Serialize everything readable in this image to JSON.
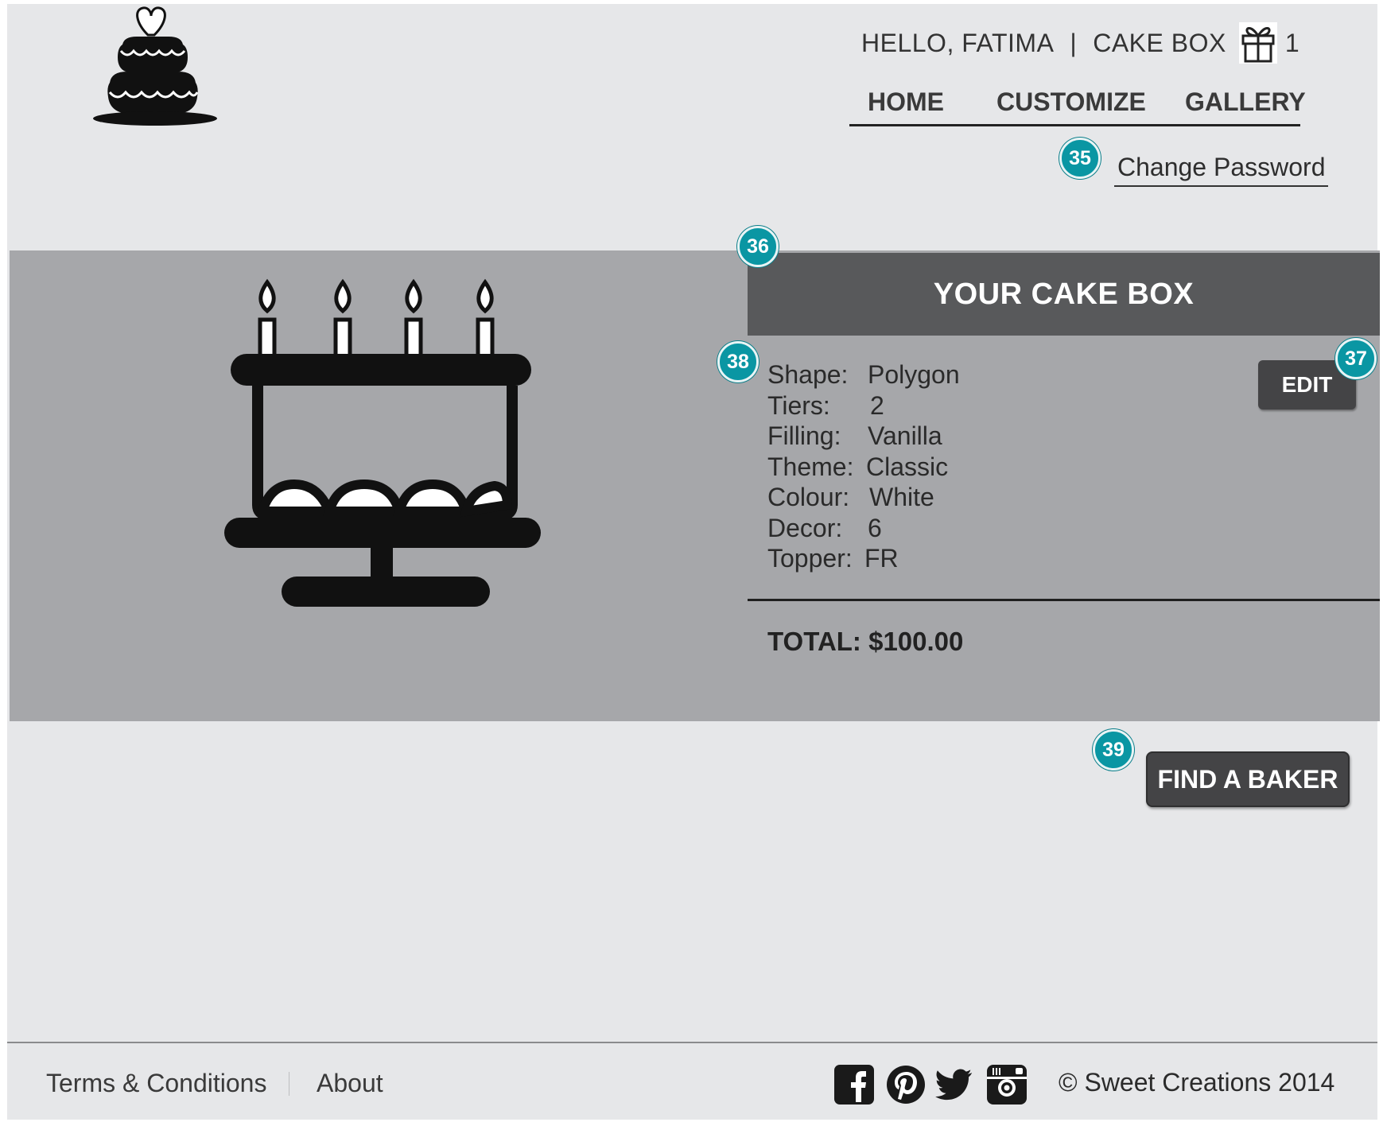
{
  "header": {
    "greeting": "HELLO, FATIMA",
    "separator": "|",
    "cart_label": "CAKE BOX",
    "cart_count": "1",
    "nav": [
      "HOME",
      "CUSTOMIZE",
      "GALLERY"
    ],
    "change_password": "Change Password"
  },
  "annotations": [
    "35",
    "36",
    "37",
    "38",
    "39"
  ],
  "cake_box": {
    "title": "YOUR CAKE BOX",
    "edit_label": "EDIT",
    "specs": [
      {
        "label": "Shape:",
        "value": "Polygon"
      },
      {
        "label": "Tiers:",
        "value": "2"
      },
      {
        "label": "Filling:",
        "value": "Vanilla"
      },
      {
        "label": "Theme:",
        "value": "Classic"
      },
      {
        "label": "Colour:",
        "value": "White"
      },
      {
        "label": "Decor:",
        "value": "6"
      },
      {
        "label": "Topper:",
        "value": "FR"
      }
    ],
    "total": "TOTAL: $100.00"
  },
  "find_baker_label": "FIND A BAKER",
  "footer": {
    "terms": "Terms & Conditions",
    "about": "About",
    "social": [
      "facebook-icon",
      "pinterest-icon",
      "twitter-icon",
      "instagram-icon"
    ],
    "copyright": "© Sweet Creations 2014"
  },
  "colors": {
    "background": "#e6e7e9",
    "band": "#a6a7aa",
    "header_bar": "#58595b",
    "button": "#444446",
    "badge": "#0a96a3"
  }
}
